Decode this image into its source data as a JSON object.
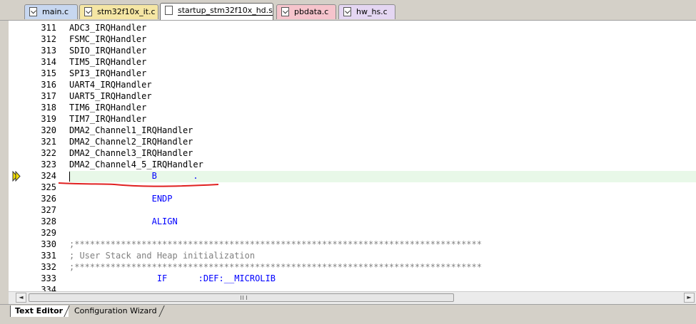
{
  "tabs": [
    {
      "label": "main.c",
      "color": "#c7d7f0",
      "icon": "file-icon"
    },
    {
      "label": "stm32f10x_it.c",
      "color": "#f5e6a4",
      "icon": "file-icon"
    },
    {
      "label": "startup_stm32f10x_hd.s",
      "color": "#ffffff",
      "icon": "file-icon",
      "active": true
    },
    {
      "label": "pbdata.c",
      "color": "#f6c4cc",
      "icon": "file-icon"
    },
    {
      "label": "hw_hs.c",
      "color": "#e4d6f2",
      "icon": "file-icon"
    }
  ],
  "editor": {
    "current_line": 324,
    "lines": [
      {
        "num": "311",
        "text": "ADC3_IRQHandler",
        "style": "plain"
      },
      {
        "num": "312",
        "text": "FSMC_IRQHandler",
        "style": "plain"
      },
      {
        "num": "313",
        "text": "SDIO_IRQHandler",
        "style": "plain"
      },
      {
        "num": "314",
        "text": "TIM5_IRQHandler",
        "style": "plain"
      },
      {
        "num": "315",
        "text": "SPI3_IRQHandler",
        "style": "plain"
      },
      {
        "num": "316",
        "text": "UART4_IRQHandler",
        "style": "plain"
      },
      {
        "num": "317",
        "text": "UART5_IRQHandler",
        "style": "plain"
      },
      {
        "num": "318",
        "text": "TIM6_IRQHandler",
        "style": "plain"
      },
      {
        "num": "319",
        "text": "TIM7_IRQHandler",
        "style": "plain"
      },
      {
        "num": "320",
        "text": "DMA2_Channel1_IRQHandler",
        "style": "plain"
      },
      {
        "num": "321",
        "text": "DMA2_Channel2_IRQHandler",
        "style": "plain"
      },
      {
        "num": "322",
        "text": "DMA2_Channel3_IRQHandler",
        "style": "plain"
      },
      {
        "num": "323",
        "text": "DMA2_Channel4_5_IRQHandler",
        "style": "plain"
      },
      {
        "num": "324",
        "text": "                B       .",
        "style": "kw"
      },
      {
        "num": "325",
        "text": "",
        "style": "plain"
      },
      {
        "num": "326",
        "text": "                ENDP",
        "style": "kw"
      },
      {
        "num": "327",
        "text": "",
        "style": "plain"
      },
      {
        "num": "328",
        "text": "                ALIGN",
        "style": "kw"
      },
      {
        "num": "329",
        "text": "",
        "style": "plain"
      },
      {
        "num": "330",
        "text": ";*******************************************************************************",
        "style": "cm"
      },
      {
        "num": "331",
        "text": "; User Stack and Heap initialization",
        "style": "cm"
      },
      {
        "num": "332",
        "text": ";*******************************************************************************",
        "style": "cm"
      },
      {
        "num": "333",
        "text": "                 IF      :DEF:__MICROLIB",
        "style": "kw"
      },
      {
        "num": "334",
        "text": "",
        "style": "plain"
      }
    ]
  },
  "scrollbar": {
    "left_arrow": "◄",
    "right_arrow": "►",
    "grip": "|||"
  },
  "bottom_tabs": {
    "text_editor": "Text Editor",
    "config_wizard": "Configuration Wizard"
  },
  "colors": {
    "current_line_bg": "#e8f8e8",
    "keyword": "#0000ff",
    "comment": "#808080",
    "annotation": "#e02020"
  }
}
